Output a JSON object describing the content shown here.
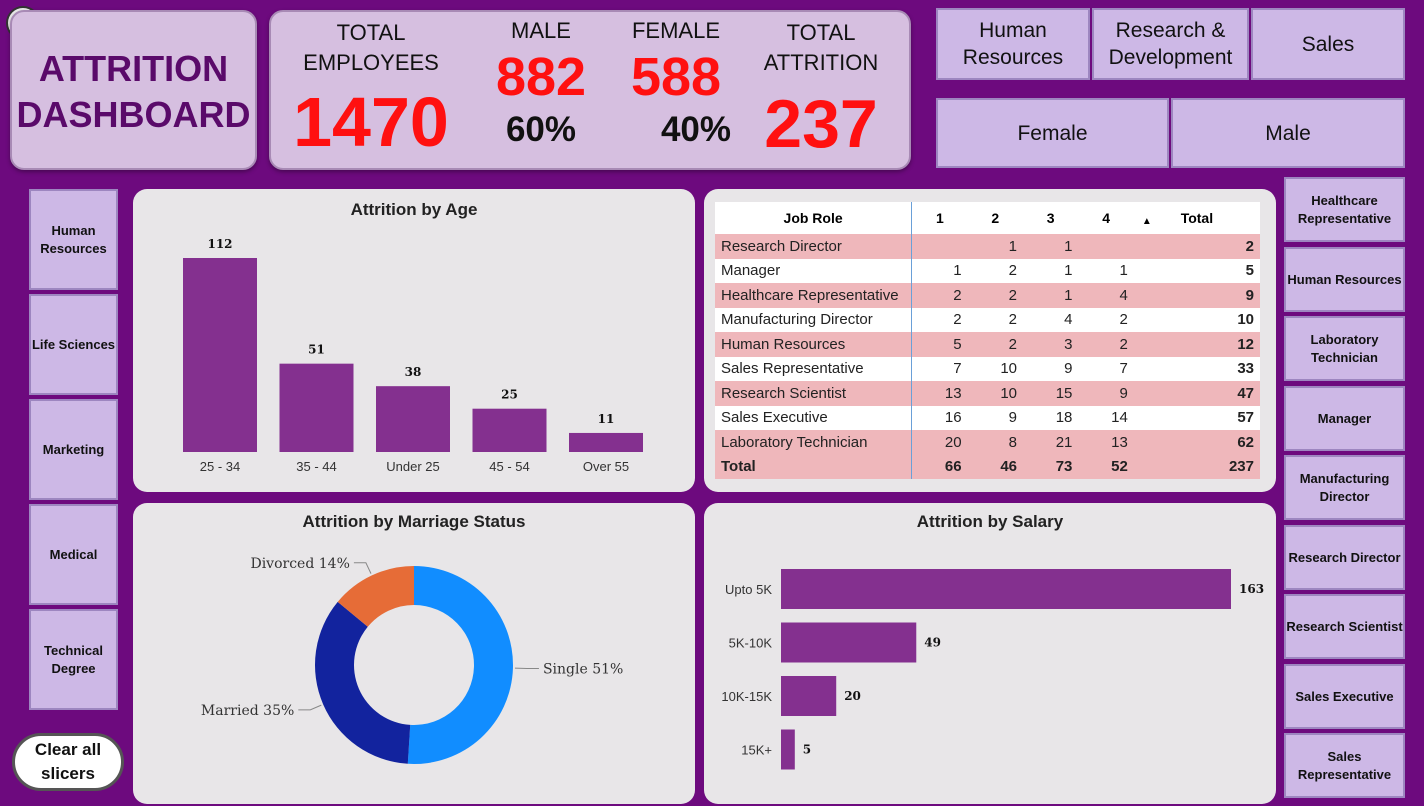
{
  "title": {
    "line1": "ATTRITION",
    "line2": "DASHBOARD"
  },
  "kpis": {
    "total_employees_label_1": "TOTAL",
    "total_employees_label_2": "EMPLOYEES",
    "total_employees": "1470",
    "male_label": "MALE",
    "male_count": "882",
    "male_pct": "60%",
    "female_label": "FEMALE",
    "female_count": "588",
    "female_pct": "40%",
    "total_attrition_label_1": "TOTAL",
    "total_attrition_label_2": "ATTRITION",
    "total_attrition": "237"
  },
  "department_slicer": [
    "Human Resources",
    "Research & Development",
    "Sales"
  ],
  "gender_slicer": [
    "Female",
    "Male"
  ],
  "education_slicer": [
    "Human Resources",
    "Life Sciences",
    "Marketing",
    "Medical",
    "Technical Degree"
  ],
  "jobrole_slicer": [
    "Healthcare Representative",
    "Human Resources",
    "Laboratory Technician",
    "Manager",
    "Manufacturing Director",
    "Research Director",
    "Research Scientist",
    "Sales Executive",
    "Sales Representative"
  ],
  "clear_button": "Clear all slicers",
  "age_chart": {
    "title": "Attrition by Age",
    "chart_data": {
      "type": "bar",
      "categories": [
        "25 - 34",
        "35 - 44",
        "Under 25",
        "45 - 54",
        "Over 55"
      ],
      "values": [
        112,
        51,
        38,
        25,
        11
      ],
      "title": "Attrition by Age",
      "color": "#84308f"
    }
  },
  "job_table": {
    "headers": [
      "Job Role",
      "1",
      "2",
      "3",
      "4",
      "Total"
    ],
    "rows": [
      [
        "Research Director",
        "",
        "1",
        "1",
        "",
        "2"
      ],
      [
        "Manager",
        "1",
        "2",
        "1",
        "1",
        "5"
      ],
      [
        "Healthcare Representative",
        "2",
        "2",
        "1",
        "4",
        "9"
      ],
      [
        "Manufacturing Director",
        "2",
        "2",
        "4",
        "2",
        "10"
      ],
      [
        "Human Resources",
        "5",
        "2",
        "3",
        "2",
        "12"
      ],
      [
        "Sales Representative",
        "7",
        "10",
        "9",
        "7",
        "33"
      ],
      [
        "Research Scientist",
        "13",
        "10",
        "15",
        "9",
        "47"
      ],
      [
        "Sales Executive",
        "16",
        "9",
        "18",
        "14",
        "57"
      ],
      [
        "Laboratory Technician",
        "20",
        "8",
        "21",
        "13",
        "62"
      ]
    ],
    "total": [
      "Total",
      "66",
      "46",
      "73",
      "52",
      "237"
    ]
  },
  "marriage_chart": {
    "title": "Attrition by Marriage Status",
    "chart_data": {
      "type": "pie",
      "labels": [
        "Single",
        "Married",
        "Divorced"
      ],
      "values": [
        51,
        35,
        14
      ],
      "display_labels": [
        "Single 51%",
        "Married 35%",
        "Divorced 14%"
      ],
      "colors": [
        "#118dff",
        "#12239e",
        "#e66c37"
      ],
      "title": "Attrition by Marriage Status"
    }
  },
  "salary_chart": {
    "title": "Attrition by Salary",
    "chart_data": {
      "type": "bar",
      "orientation": "horizontal",
      "categories": [
        "Upto 5K",
        "5K-10K",
        "10K-15K",
        "15K+"
      ],
      "values": [
        163,
        49,
        20,
        5
      ],
      "title": "Attrition by Salary",
      "color": "#84308f"
    }
  }
}
